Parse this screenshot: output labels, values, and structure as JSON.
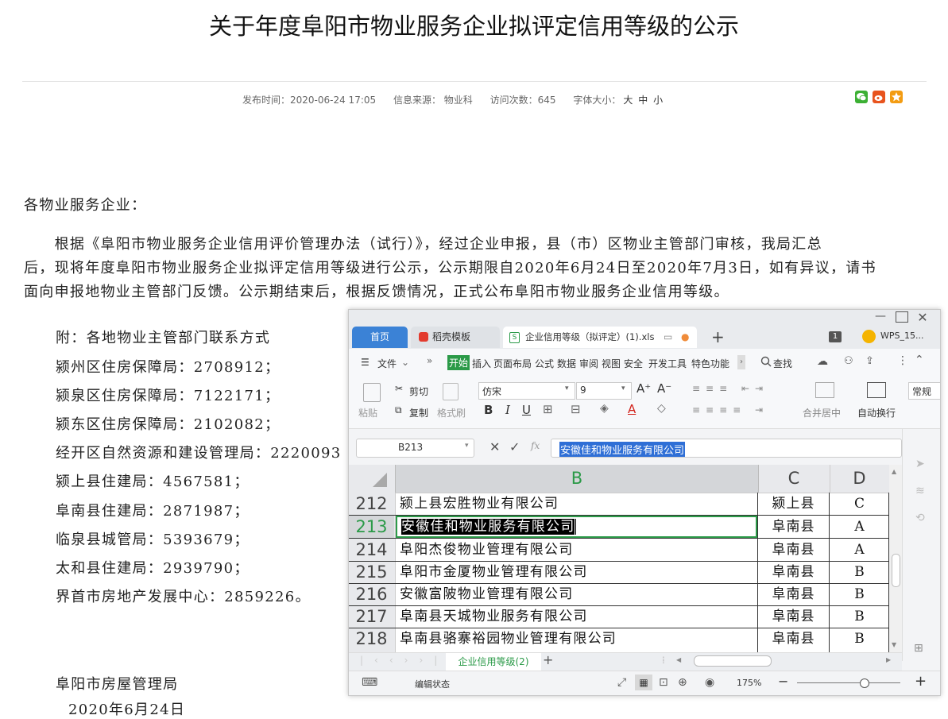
{
  "article": {
    "title": "关于年度阜阳市物业服务企业拟评定信用等级的公示",
    "meta": {
      "publish": "发布时间：2020-06-24 17:05",
      "source": "信息来源： 物业科",
      "visits": "访问次数：645",
      "font_label": "字体大小：",
      "font_large": "大",
      "font_medium": "中",
      "font_small": "小"
    },
    "salutation": "各物业服务企业：",
    "body_lines": [
      "　　根据《阜阳市物业服务企业信用评价管理办法（试行）》，经过企业申报，县（市）区物业主管部门审核，我局汇总",
      "后，现将年度阜阳市物业服务企业拟评定信用等级进行公示，公示期限自2020年6月24日至2020年7月3日，如有异议，请书",
      "面向申报地物业主管部门反馈。公示期结束后，根据反馈情况，正式公布阜阳市物业服务企业信用等级。"
    ],
    "attachment_title": "附：各地物业主管部门联系方式",
    "contacts": [
      "颍州区住房保障局：2708912；",
      "颍泉区住房保障局：7122171；",
      "颍东区住房保障局：2102082；",
      "经开区自然资源和建设管理局：2220093",
      "颍上县住建局：4567581；",
      "阜南县住建局：2871987；",
      "临泉县城管局：5393679；",
      "太和县住建局：2939790；",
      "界首市房地产发展中心：2859226。"
    ],
    "signature": "阜阳市房屋管理局",
    "date": "2020年6月24日"
  },
  "wps": {
    "tabs": {
      "home": "首页",
      "template": "稻壳模板",
      "file": "企业信用等级（拟评定）(1).xls",
      "count": "1",
      "account": "WPS_15..."
    },
    "menu": [
      "文件",
      "开始",
      "插入",
      "页面布局",
      "公式",
      "数据",
      "审阅",
      "视图",
      "安全",
      "开发工具",
      "特色功能"
    ],
    "search": "查找",
    "toolbar": {
      "cut": "剪切",
      "copy": "复制",
      "paste": "粘贴",
      "format_painter": "格式刷",
      "font": "仿宋",
      "size": "9",
      "merge": "合并居中",
      "wrap": "自动换行",
      "number_format": "常规"
    },
    "name_box": "B213",
    "formula": "安徽佳和物业服务有限公司",
    "fx": "fx",
    "columns": [
      "B",
      "C",
      "D"
    ],
    "rows": [
      {
        "num": "212",
        "b": "颍上县宏胜物业有限公司",
        "c": "颍上县",
        "d": "C"
      },
      {
        "num": "213",
        "b": "安徽佳和物业服务有限公司",
        "c": "阜南县",
        "d": "A"
      },
      {
        "num": "214",
        "b": "阜阳杰俊物业管理有限公司",
        "c": "阜南县",
        "d": "A"
      },
      {
        "num": "215",
        "b": "阜阳市金厦物业管理有限公司",
        "c": "阜南县",
        "d": "B"
      },
      {
        "num": "216",
        "b": "安徽富陂物业管理有限公司",
        "c": "阜南县",
        "d": "B"
      },
      {
        "num": "217",
        "b": "阜南县天城物业服务有限公司",
        "c": "阜南县",
        "d": "B"
      },
      {
        "num": "218",
        "b": "阜南县骆寨裕园物业管理有限公司",
        "c": "阜南县",
        "d": "B"
      }
    ],
    "sheet_tab": "企业信用等级(2)",
    "status": "编辑状态",
    "zoom": "175%",
    "colors": {
      "accent": "#2b9a48",
      "tab_blue": "#3b82d6",
      "selection": "#000000"
    }
  }
}
